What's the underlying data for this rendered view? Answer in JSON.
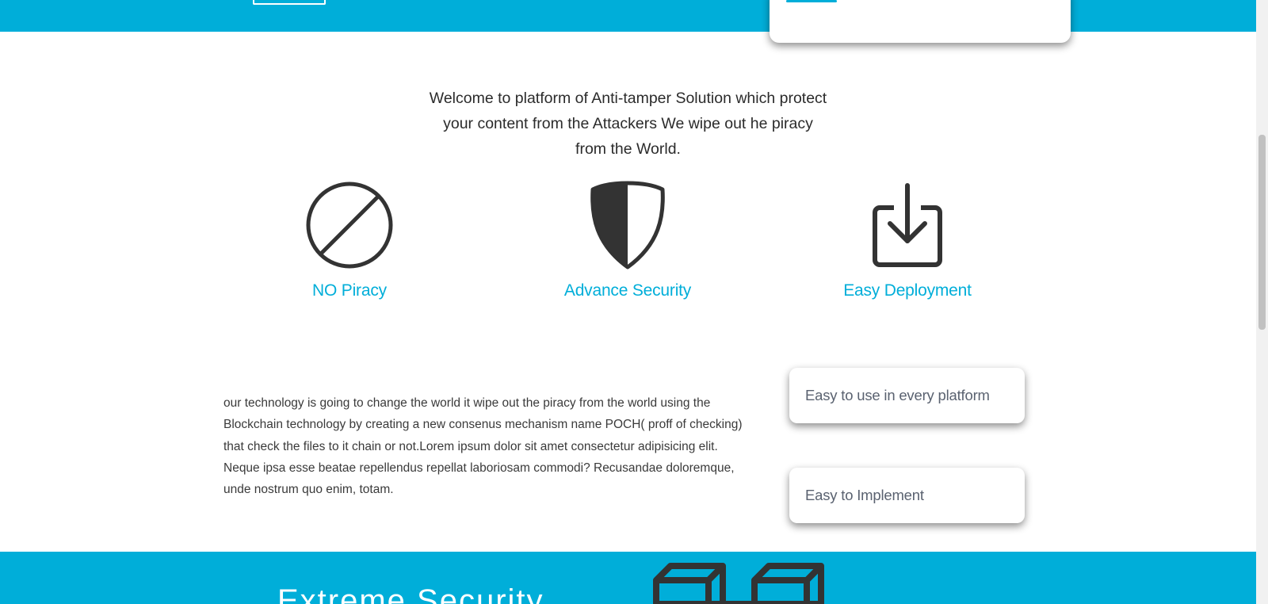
{
  "welcome": {
    "text": "Welcome to platform of Anti-tamper Solution which protect your content from the Attackers We wipe out he piracy from the World."
  },
  "features": [
    {
      "label": "NO Piracy",
      "icon": "ban-icon"
    },
    {
      "label": "Advance Security",
      "icon": "shield-icon"
    },
    {
      "label": "Easy Deployment",
      "icon": "download-icon"
    }
  ],
  "description": "our technology is going to change the world it wipe out the piracy from the world using the Blockchain technology by creating a new consenus mechanism name POCH( proff of checking) that check the files to it chain or not.Lorem ipsum dolor sit amet consectetur adipisicing elit. Neque ipsa esse beatae repellendus repellat laboriosam commodi? Recusandae doloremque, unde nostrum quo enim, totam.",
  "cards": [
    {
      "label": "Easy to use in every platform"
    },
    {
      "label": "Easy to Implement"
    }
  ],
  "bottom": {
    "title": "Extreme Security",
    "icon": "blockchain-cubes-icon"
  },
  "colors": {
    "accent": "#00aed9",
    "text": "#333333"
  }
}
